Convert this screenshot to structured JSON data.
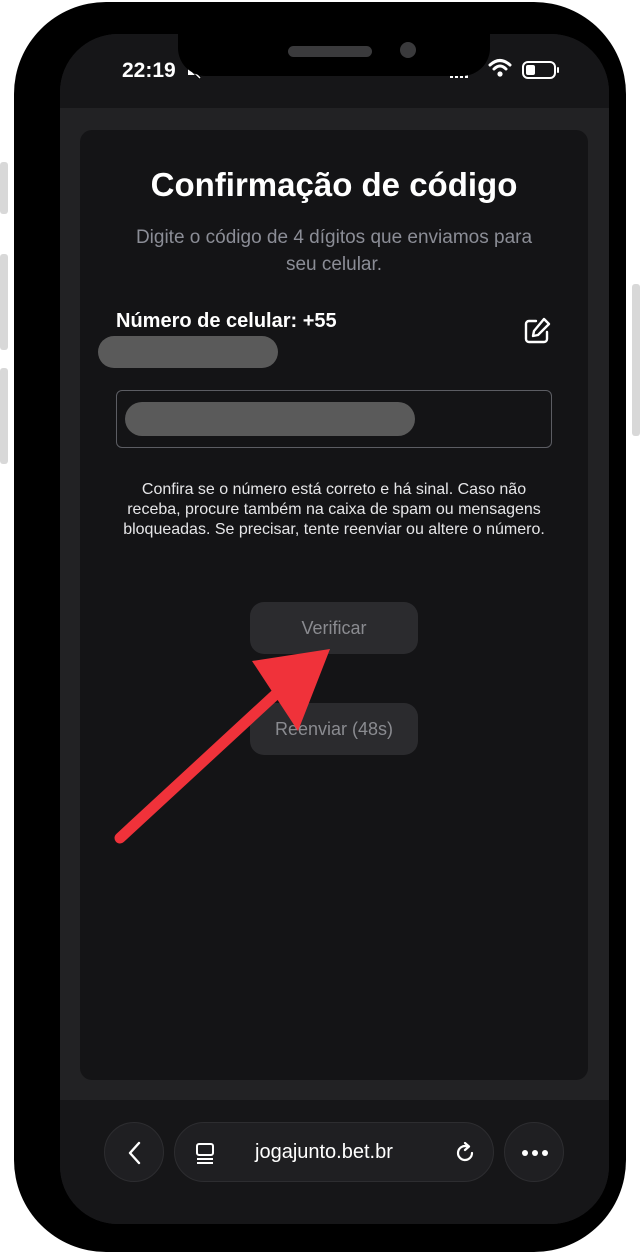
{
  "status_bar": {
    "time": "22:19",
    "icons": [
      "bell-slash-icon",
      "signal-icon",
      "wifi-icon",
      "battery-icon"
    ]
  },
  "confirm": {
    "title": "Confirmação de código",
    "subtitle": "Digite o código de 4 dígitos que enviamos para seu celular.",
    "phone_label": "Número de celular: +55",
    "info": "Confira se o número está correto e há sinal. Caso não receba, procure também na caixa de spam ou mensagens bloqueadas. Se precisar, tente reenviar ou altere o número.",
    "verify_label": "Verificar",
    "resend_label": "Reenviar (48s)"
  },
  "browser": {
    "url": "jogajunto.bet.br",
    "icons": [
      "chevron-left-icon",
      "tabs-icon",
      "reload-icon",
      "more-icon"
    ]
  },
  "colors": {
    "background": "#1c1c1e",
    "card": "#141416",
    "button": "#2b2b2e",
    "arrow": "#f0323a"
  }
}
